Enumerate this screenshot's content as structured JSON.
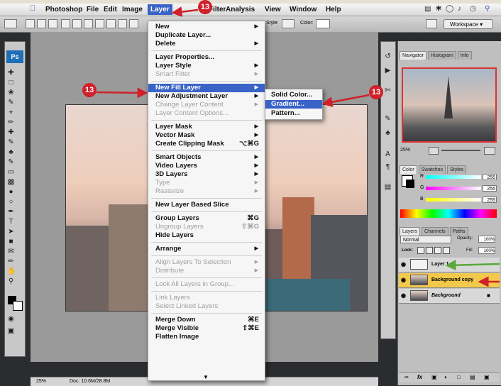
{
  "menubar": {
    "app": "Photoshop",
    "items": [
      "File",
      "Edit",
      "Image",
      "Layer",
      "Filter",
      "Analysis",
      "View",
      "Window",
      "Help"
    ]
  },
  "optionsbar": {
    "style_label": "Style:",
    "color_label": "Color:",
    "workspace": "Workspace ▾"
  },
  "toolbox": {
    "logo": "Ps"
  },
  "layer_menu": [
    {
      "label": "New",
      "type": "sub"
    },
    {
      "label": "Duplicate Layer...",
      "type": "item"
    },
    {
      "label": "Delete",
      "type": "sub"
    },
    {
      "type": "sep"
    },
    {
      "label": "Layer Properties...",
      "type": "item"
    },
    {
      "label": "Layer Style",
      "type": "sub"
    },
    {
      "label": "Smart Filter",
      "type": "dissub"
    },
    {
      "type": "sep"
    },
    {
      "label": "New Fill Layer",
      "type": "hl"
    },
    {
      "label": "New Adjustment Layer",
      "type": "sub"
    },
    {
      "label": "Change Layer Content",
      "type": "dissub"
    },
    {
      "label": "Layer Content Options...",
      "type": "dis"
    },
    {
      "type": "sep"
    },
    {
      "label": "Layer Mask",
      "type": "sub"
    },
    {
      "label": "Vector Mask",
      "type": "sub"
    },
    {
      "label": "Create Clipping Mask",
      "type": "sc",
      "shortcut": "⌥⌘G"
    },
    {
      "type": "sep"
    },
    {
      "label": "Smart Objects",
      "type": "sub"
    },
    {
      "label": "Video Layers",
      "type": "sub"
    },
    {
      "label": "3D Layers",
      "type": "sub"
    },
    {
      "label": "Type",
      "type": "dissub"
    },
    {
      "label": "Rasterize",
      "type": "dissub"
    },
    {
      "type": "sep"
    },
    {
      "label": "New Layer Based Slice",
      "type": "item"
    },
    {
      "type": "sep"
    },
    {
      "label": "Group Layers",
      "type": "sc",
      "shortcut": "⌘G"
    },
    {
      "label": "Ungroup Layers",
      "type": "dissc",
      "shortcut": "⇧⌘G"
    },
    {
      "label": "Hide Layers",
      "type": "item"
    },
    {
      "type": "sep"
    },
    {
      "label": "Arrange",
      "type": "sub"
    },
    {
      "type": "sep"
    },
    {
      "label": "Align Layers To Selection",
      "type": "dissub"
    },
    {
      "label": "Distribute",
      "type": "dissub"
    },
    {
      "type": "sep"
    },
    {
      "label": "Lock All Layers in Group...",
      "type": "dis"
    },
    {
      "type": "sep"
    },
    {
      "label": "Link Layers",
      "type": "dis"
    },
    {
      "label": "Select Linked Layers",
      "type": "dis"
    },
    {
      "type": "sep"
    },
    {
      "label": "Merge Down",
      "type": "sc",
      "shortcut": "⌘E"
    },
    {
      "label": "Merge Visible",
      "type": "sc",
      "shortcut": "⇧⌘E"
    },
    {
      "label": "Flatten Image",
      "type": "item"
    }
  ],
  "fill_submenu": [
    {
      "label": "Solid Color...",
      "highlighted": false
    },
    {
      "label": "Gradient...",
      "highlighted": true
    },
    {
      "label": "Pattern...",
      "highlighted": false
    }
  ],
  "navigator": {
    "tabs": [
      "Navigator",
      "Histogram",
      "Info"
    ],
    "zoom": "25%"
  },
  "color_panel": {
    "tabs": [
      "Color",
      "Swatches",
      "Styles"
    ],
    "channels": [
      {
        "label": "R",
        "value": "255"
      },
      {
        "label": "G",
        "value": "255"
      },
      {
        "label": "B",
        "value": "255"
      }
    ]
  },
  "layers_panel": {
    "tabs": [
      "Layers",
      "Channels",
      "Paths"
    ],
    "blend_mode": "Normal",
    "opacity_label": "Opacity:",
    "opacity": "100%",
    "lock_label": "Lock:",
    "fill_label": "Fill:",
    "fill": "100%",
    "layers": [
      {
        "name": "Layer 1",
        "selected": false
      },
      {
        "name": "Background copy",
        "selected": true
      },
      {
        "name": "Background",
        "selected": false
      }
    ]
  },
  "status": {
    "zoom": "25%",
    "doc": "Doc: 10.6M/28.8M"
  },
  "callouts": [
    "13",
    "13",
    "13"
  ],
  "colors": {
    "menu_highlight": "#3a63c8",
    "callout": "#d0202a",
    "selected_layer": "#f2c94a"
  }
}
